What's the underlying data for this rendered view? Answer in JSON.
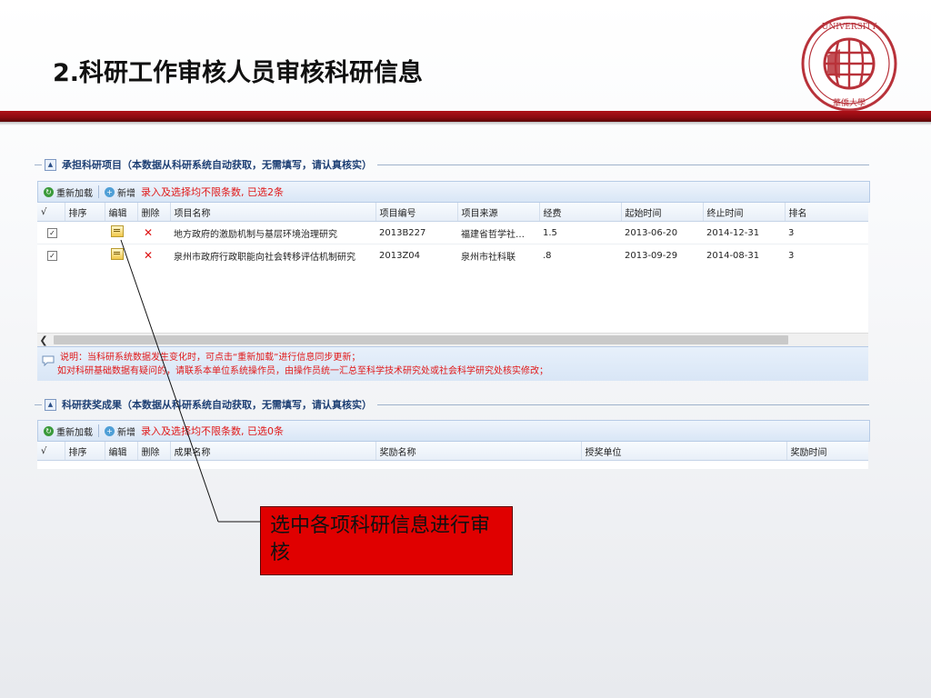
{
  "slide": {
    "title": "2.科研工作审核人员审核科研信息"
  },
  "logo": {
    "text": "HUAQIAO UNIVERSITY",
    "sub": "華僑大學"
  },
  "project_section": {
    "header": "承担科研项目（本数据从科研系统自动获取，无需填写，请认真核实）",
    "toolbar": {
      "reload": "重新加载",
      "add": "新增",
      "message": "录入及选择均不限条数, 已选2条"
    },
    "columns": [
      "√",
      "排序",
      "编辑",
      "删除",
      "项目名称",
      "项目编号",
      "项目来源",
      "经费",
      "起始时间",
      "终止时间",
      "排名"
    ],
    "rows": [
      {
        "checked": "✓",
        "name": "地方政府的激励机制与基层环境治理研究",
        "code": "2013B227",
        "source": "福建省哲学社…",
        "funds": "1.5",
        "start": "2013-06-20",
        "end": "2014-12-31",
        "rank": "3"
      },
      {
        "checked": "✓",
        "name": "泉州市政府行政职能向社会转移评估机制研究",
        "code": "2013Z04",
        "source": "泉州市社科联",
        "funds": ".8",
        "start": "2013-09-29",
        "end": "2014-08-31",
        "rank": "3"
      }
    ],
    "note_line1": "说明：当科研系统数据发生变化时，可点击“重新加载”进行信息同步更新；",
    "note_line2": "如对科研基础数据有疑问的，请联系本单位系统操作员，由操作员统一汇总至科学技术研究处或社会科学研究处核实修改；"
  },
  "award_section": {
    "header": "科研获奖成果（本数据从科研系统自动获取，无需填写，请认真核实）",
    "toolbar": {
      "reload": "重新加载",
      "add": "新增",
      "message": "录入及选择均不限条数, 已选0条"
    },
    "columns": [
      "√",
      "排序",
      "编辑",
      "删除",
      "成果名称",
      "奖励名称",
      "授奖单位",
      "奖励时间"
    ]
  },
  "callout": {
    "text": "选中各项科研信息进行审核"
  }
}
